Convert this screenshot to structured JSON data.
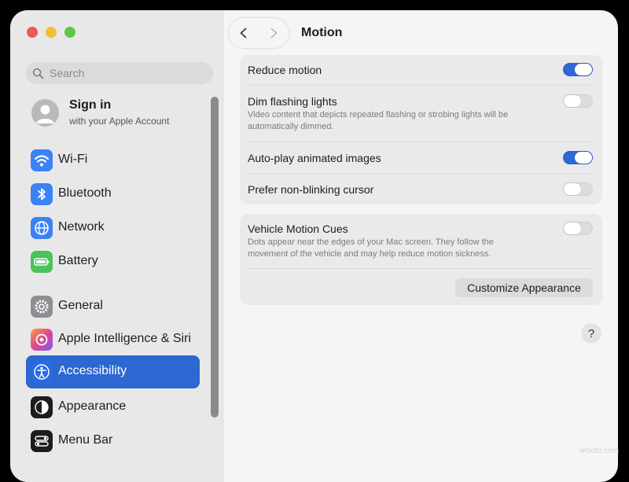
{
  "window": {
    "colors": {
      "accent": "#2c67d2",
      "red": "#ee5b54",
      "yellow": "#f3bd3b",
      "green": "#5fc548"
    }
  },
  "sidebar": {
    "search": {
      "placeholder": "Search",
      "icon": "search-icon"
    },
    "account": {
      "title": "Sign in",
      "subtitle": "with your Apple Account",
      "icon": "person-icon"
    },
    "items": [
      {
        "id": "wifi",
        "label": "Wi-Fi",
        "icon": "wifi-icon",
        "color": "#3b82f6",
        "selected": false
      },
      {
        "id": "bluetooth",
        "label": "Bluetooth",
        "icon": "bluetooth-icon",
        "color": "#3b82f6",
        "selected": false
      },
      {
        "id": "network",
        "label": "Network",
        "icon": "globe-icon",
        "color": "#3b82f6",
        "selected": false
      },
      {
        "id": "battery",
        "label": "Battery",
        "icon": "battery-icon",
        "color": "#4cc35a",
        "selected": false
      },
      {
        "id": "general",
        "label": "General",
        "icon": "gear-icon",
        "color": "#8e8e93",
        "selected": false
      },
      {
        "id": "siri",
        "label": "Apple Intelligence & Siri",
        "icon": "siri-icon",
        "color": "#b24cf0",
        "selected": false
      },
      {
        "id": "accessibility",
        "label": "Accessibility",
        "icon": "accessibility-icon",
        "color": "#2c67d2",
        "selected": true
      },
      {
        "id": "appearance",
        "label": "Appearance",
        "icon": "appearance-icon",
        "color": "#1c1c1e",
        "selected": false
      },
      {
        "id": "menubar",
        "label": "Menu Bar",
        "icon": "menu-bar-icon",
        "color": "#1c1c1e",
        "selected": false
      }
    ]
  },
  "toolbar": {
    "title": "Motion",
    "back_icon": "chevron-left-icon",
    "forward_icon": "chevron-right-icon"
  },
  "motion": {
    "reduce_motion": {
      "label": "Reduce motion",
      "on": true
    },
    "dim_flashing": {
      "label": "Dim flashing lights",
      "desc_line1": "Video content that depicts repeated flashing or strobing lights will be",
      "desc_line2": "automatically dimmed.",
      "on": false
    },
    "autoplay": {
      "label": "Auto-play animated images",
      "on": true
    },
    "non_blinking": {
      "label": "Prefer non-blinking cursor",
      "on": false
    }
  },
  "vehicle": {
    "label": "Vehicle Motion Cues",
    "desc_line1": "Dots appear near the edges of your Mac screen. They follow the",
    "desc_line2": "movement of the vehicle and may help reduce motion sickness.",
    "on": false,
    "button_label": "Customize Appearance"
  },
  "help": {
    "label": "?"
  },
  "watermark": "wsxdn.com"
}
